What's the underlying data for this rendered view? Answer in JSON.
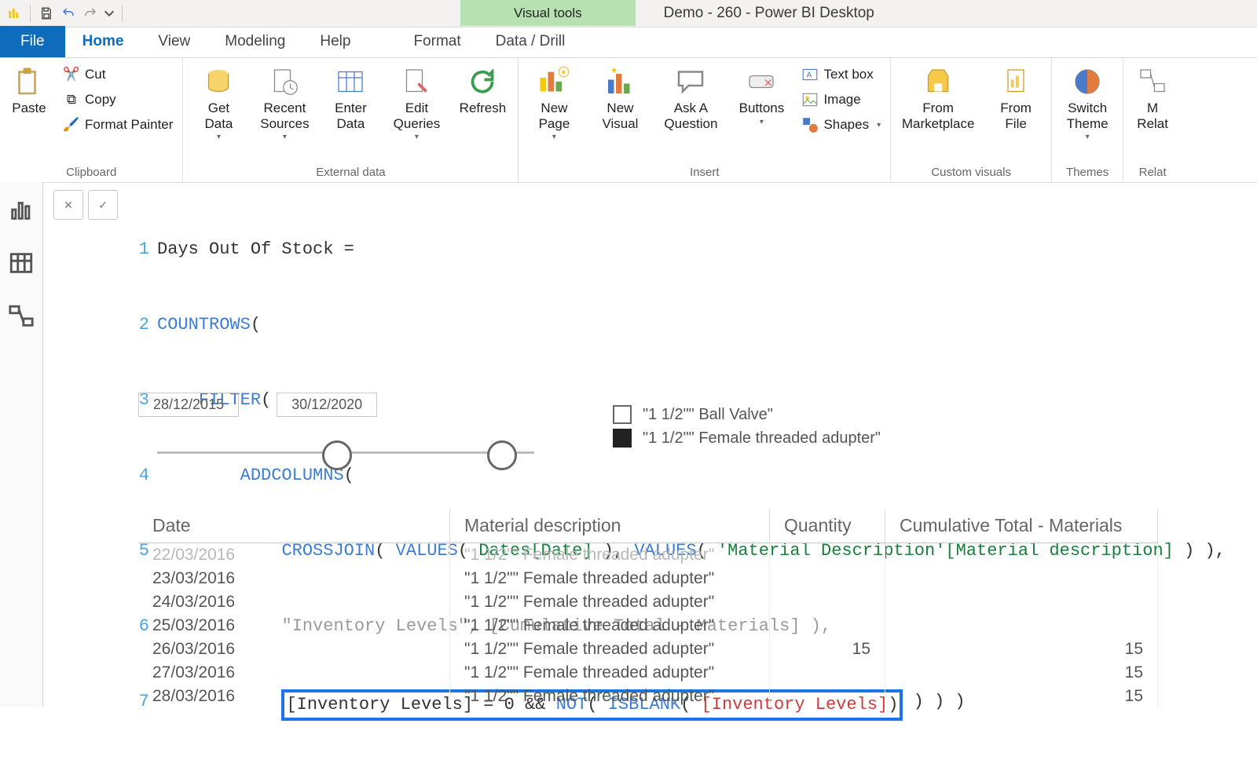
{
  "app": {
    "title": "Demo - 260 - Power BI Desktop",
    "visual_tools_label": "Visual tools"
  },
  "tabs": {
    "file": "File",
    "home": "Home",
    "view": "View",
    "modeling": "Modeling",
    "help": "Help",
    "format": "Format",
    "data_drill": "Data / Drill"
  },
  "ribbon": {
    "clipboard": {
      "label": "Clipboard",
      "paste": "Paste",
      "cut": "Cut",
      "copy": "Copy",
      "format_painter": "Format Painter"
    },
    "external": {
      "label": "External data",
      "get_data": "Get\nData",
      "recent_sources": "Recent\nSources",
      "enter_data": "Enter\nData",
      "edit_queries": "Edit\nQueries",
      "refresh": "Refresh"
    },
    "insert": {
      "label": "Insert",
      "new_page": "New\nPage",
      "new_visual": "New\nVisual",
      "ask": "Ask A\nQuestion",
      "buttons": "Buttons",
      "textbox": "Text box",
      "image": "Image",
      "shapes": "Shapes"
    },
    "custom": {
      "label": "Custom visuals",
      "from_marketplace": "From\nMarketplace",
      "from_file": "From\nFile"
    },
    "themes": {
      "label": "Themes",
      "switch_theme": "Switch\nTheme"
    },
    "relat": {
      "label": "Relat",
      "btn": "M\nRelat"
    }
  },
  "formula": {
    "l1": "Days Out Of Stock =",
    "l2_fn": "COUNTROWS",
    "l2_rest": "(",
    "l3_fn": "FILTER",
    "l3_rest": "(",
    "l4_fn": "ADDCOLUMNS",
    "l4_rest": "(",
    "l5_fn1": "CROSSJOIN",
    "l5_p1": "( ",
    "l5_fn2": "VALUES",
    "l5_p2": "( ",
    "l5_tbl1": "Dates[Date]",
    "l5_p3": " ), ",
    "l5_fn3": "VALUES",
    "l5_p4": "( ",
    "l5_tbl2": "'Material Description'[Material description]",
    "l5_p5": " ) ),",
    "l6_str": "\"Inventory Levels\"",
    "l6_mid": ", ",
    "l6_col": "[Cumulative Total - Materials]",
    "l6_end": " ),",
    "l7_pre": "[Inventory Levels] = 0 ",
    "l7_and": "&& ",
    "l7_not": "NOT",
    "l7_p1": "( ",
    "l7_isb": "ISBLANK",
    "l7_p2": "( ",
    "l7_col": "[Inventory Levels]",
    "l7_p3": ")",
    "l7_tail": " ) ) )"
  },
  "slicer": {
    "start": "28/12/2015",
    "end": "30/12/2020"
  },
  "legend": {
    "item1": "\"1 1/2\"\" Ball Valve\"",
    "item2": "\"1 1/2\"\" Female threaded adupter\""
  },
  "table": {
    "headers": {
      "date": "Date",
      "desc": "Material description",
      "qty": "Quantity",
      "cum": "Cumulative Total - Materials"
    },
    "rows": [
      {
        "date": "22/03/2016",
        "desc": "\"1 1/2\"\" Female threaded adupter\"",
        "qty": "",
        "cum": ""
      },
      {
        "date": "23/03/2016",
        "desc": "\"1 1/2\"\" Female threaded adupter\"",
        "qty": "",
        "cum": ""
      },
      {
        "date": "24/03/2016",
        "desc": "\"1 1/2\"\" Female threaded adupter\"",
        "qty": "",
        "cum": ""
      },
      {
        "date": "25/03/2016",
        "desc": "\"1 1/2\"\" Female threaded adupter\"",
        "qty": "",
        "cum": ""
      },
      {
        "date": "26/03/2016",
        "desc": "\"1 1/2\"\" Female threaded adupter\"",
        "qty": "15",
        "cum": "15"
      },
      {
        "date": "27/03/2016",
        "desc": "\"1 1/2\"\" Female threaded adupter\"",
        "qty": "",
        "cum": "15"
      },
      {
        "date": "28/03/2016",
        "desc": "\"1 1/2\"\" Female threaded adupter\"",
        "qty": "",
        "cum": "15"
      }
    ]
  }
}
